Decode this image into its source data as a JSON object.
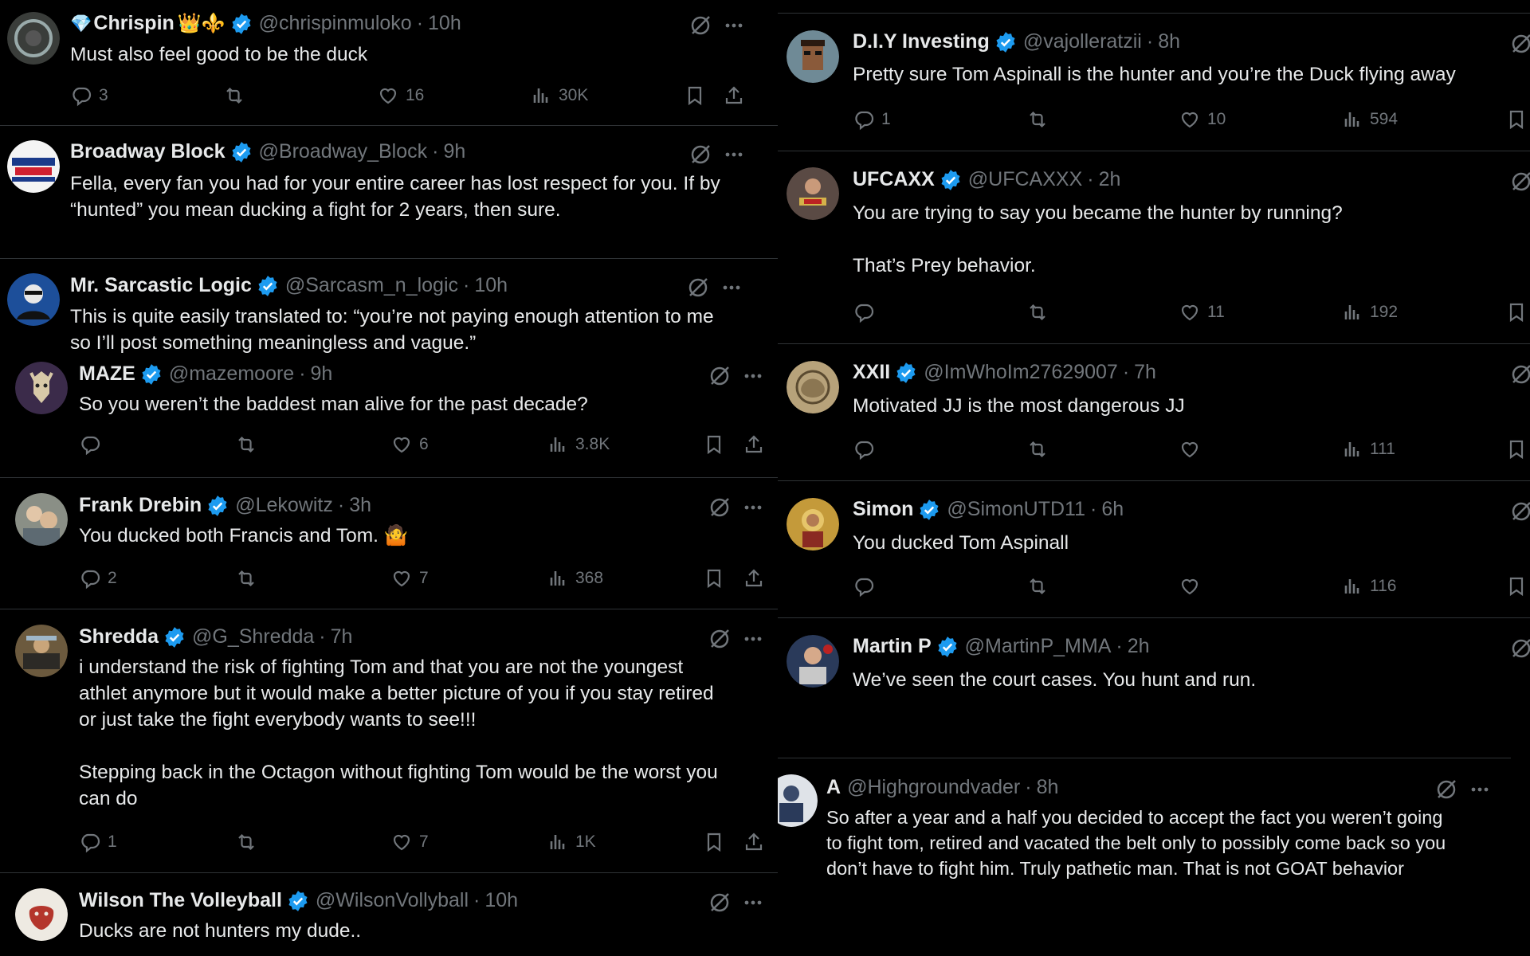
{
  "left_tweets": [
    {
      "name": "Chrispin",
      "badges": "👑⚜️",
      "handle": "@chrispinmuloko",
      "time": "10h",
      "text": "Must also feel good to be the duck",
      "replies": "3",
      "likes": "16",
      "views": "30K"
    },
    {
      "name": "Broadway Block",
      "handle": "@Broadway_Block",
      "time": "9h",
      "text": "Fella, every fan you had for your entire career has lost respect for you. If by\n“hunted” you mean ducking a fight for 2 years, then sure."
    },
    {
      "name": "Mr. Sarcastic Logic",
      "handle": "@Sarcasm_n_logic",
      "time": "10h",
      "text": "This is quite easily translated to: “you’re not paying enough attention to me\nso I’ll post something meaningless and vague.”"
    },
    {
      "name": "MAZE",
      "handle": "@mazemoore",
      "time": "9h",
      "text": "So you weren’t the baddest man alive for the past decade?",
      "likes": "6",
      "views": "3.8K"
    },
    {
      "name": "Frank Drebin",
      "handle": "@Lekowitz",
      "time": "3h",
      "text": "You ducked both Francis and Tom. 🤷",
      "replies": "2",
      "likes": "7",
      "views": "368"
    },
    {
      "name": "Shredda",
      "handle": "@G_Shredda",
      "time": "7h",
      "text": "i understand the risk of fighting Tom and that you are not the youngest\nathlet anymore but it would make a better picture of you if you stay retired\nor just take the fight everybody wants to see!!!\n\nStepping back in the Octagon without fighting Tom would be the worst you\ncan do",
      "replies": "1",
      "likes": "7",
      "views": "1K"
    },
    {
      "name": "Wilson The Volleyball",
      "handle": "@WilsonVollyball",
      "time": "10h",
      "text": "Ducks are not hunters my dude.."
    }
  ],
  "right_tweets": [
    {
      "name": "D.I.Y Investing",
      "handle": "@vajolleratzii",
      "time": "8h",
      "text": "Pretty sure Tom Aspinall is the hunter and you’re the Duck flying away",
      "replies": "1",
      "likes": "10",
      "views": "594"
    },
    {
      "name": "UFCAXX",
      "handle": "@UFCAXXX",
      "time": "2h",
      "text": "You are trying to say you became the hunter by running?\n\nThat’s Prey behavior.",
      "likes": "11",
      "views": "192"
    },
    {
      "name": "XXII",
      "handle": "@ImWhoIm27629007",
      "time": "7h",
      "text": "Motivated JJ is the most dangerous JJ",
      "views": "111"
    },
    {
      "name": "Simon",
      "handle": "@SimonUTD11",
      "time": "6h",
      "text": "You ducked Tom Aspinall",
      "views": "116"
    },
    {
      "name": "Martin P",
      "handle": "@MartinP_MMA",
      "time": "2h",
      "text": "We’ve seen the court cases. You hunt and run."
    },
    {
      "name": "A",
      "handle": "@Highgroundvader",
      "time": "8h",
      "text": "So after a year and a half you decided to accept the fact you weren’t going\nto fight tom, retired and vacated the belt only to possibly come back so you\ndon’t have to fight him. Truly pathetic man. That is not GOAT behavior"
    }
  ],
  "colors": {
    "background": "#000000",
    "text": "#e7e9ea",
    "muted": "#71767b",
    "verified": "#1d9bf0",
    "divider": "#2f3336"
  },
  "icons": [
    "diamond-icon",
    "grok-icon",
    "more-icon",
    "reply-icon",
    "repost-icon",
    "like-icon",
    "views-icon",
    "bookmark-icon",
    "share-icon",
    "verified-badge-icon"
  ]
}
